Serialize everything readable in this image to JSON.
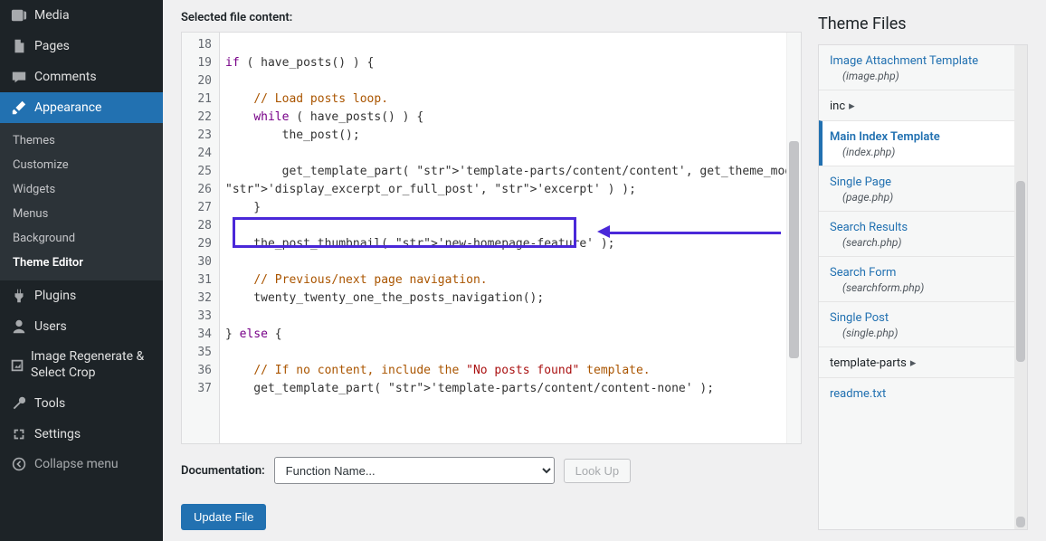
{
  "sidebar": {
    "top": [
      {
        "icon": "media",
        "label": "Media"
      },
      {
        "icon": "pages",
        "label": "Pages"
      },
      {
        "icon": "comments",
        "label": "Comments"
      }
    ],
    "appearance": {
      "icon": "brush",
      "label": "Appearance",
      "sub": [
        "Themes",
        "Customize",
        "Widgets",
        "Menus",
        "Background",
        "Theme Editor"
      ],
      "current_sub": "Theme Editor"
    },
    "bottom": [
      {
        "icon": "plugins",
        "label": "Plugins"
      },
      {
        "icon": "users",
        "label": "Users"
      },
      {
        "icon": "regen",
        "label": "Image Regenerate & Select Crop"
      },
      {
        "icon": "tools",
        "label": "Tools"
      },
      {
        "icon": "settings",
        "label": "Settings"
      }
    ],
    "collapse": "Collapse menu"
  },
  "editor": {
    "selected_label": "Selected file content:",
    "first_line_no": 18,
    "lines": [
      "",
      "if ( have_posts() ) {",
      "",
      "    // Load posts loop.",
      "    while ( have_posts() ) {",
      "        the_post();",
      "",
      "        get_template_part( 'template-parts/content/content', get_theme_mod(",
      "'display_excerpt_or_full_post', 'excerpt' ) );",
      "    }",
      "",
      "    the_post_thumbnail( 'new-homepage-feature' );",
      "",
      "    // Previous/next page navigation.",
      "    twenty_twenty_one_the_posts_navigation();",
      "",
      "} else {",
      "",
      "    // If no content, include the \"No posts found\" template.",
      "    get_template_part( 'template-parts/content/content-none' );"
    ],
    "documentation_label": "Documentation:",
    "doc_select_placeholder": "Function Name...",
    "lookup_label": "Look Up",
    "update_label": "Update File"
  },
  "files": {
    "title": "Theme Files",
    "items": [
      {
        "title": "Image Attachment Template",
        "file": "(image.php)",
        "type": "file"
      },
      {
        "title": "inc",
        "type": "folder"
      },
      {
        "title": "Main Index Template",
        "file": "(index.php)",
        "type": "file",
        "current": true
      },
      {
        "title": "Single Page",
        "file": "(page.php)",
        "type": "file"
      },
      {
        "title": "Search Results",
        "file": "(search.php)",
        "type": "file"
      },
      {
        "title": "Search Form",
        "file": "(searchform.php)",
        "type": "file"
      },
      {
        "title": "Single Post",
        "file": "(single.php)",
        "type": "file"
      },
      {
        "title": "template-parts",
        "type": "folder"
      },
      {
        "title": "readme.txt",
        "type": "plain"
      }
    ]
  }
}
